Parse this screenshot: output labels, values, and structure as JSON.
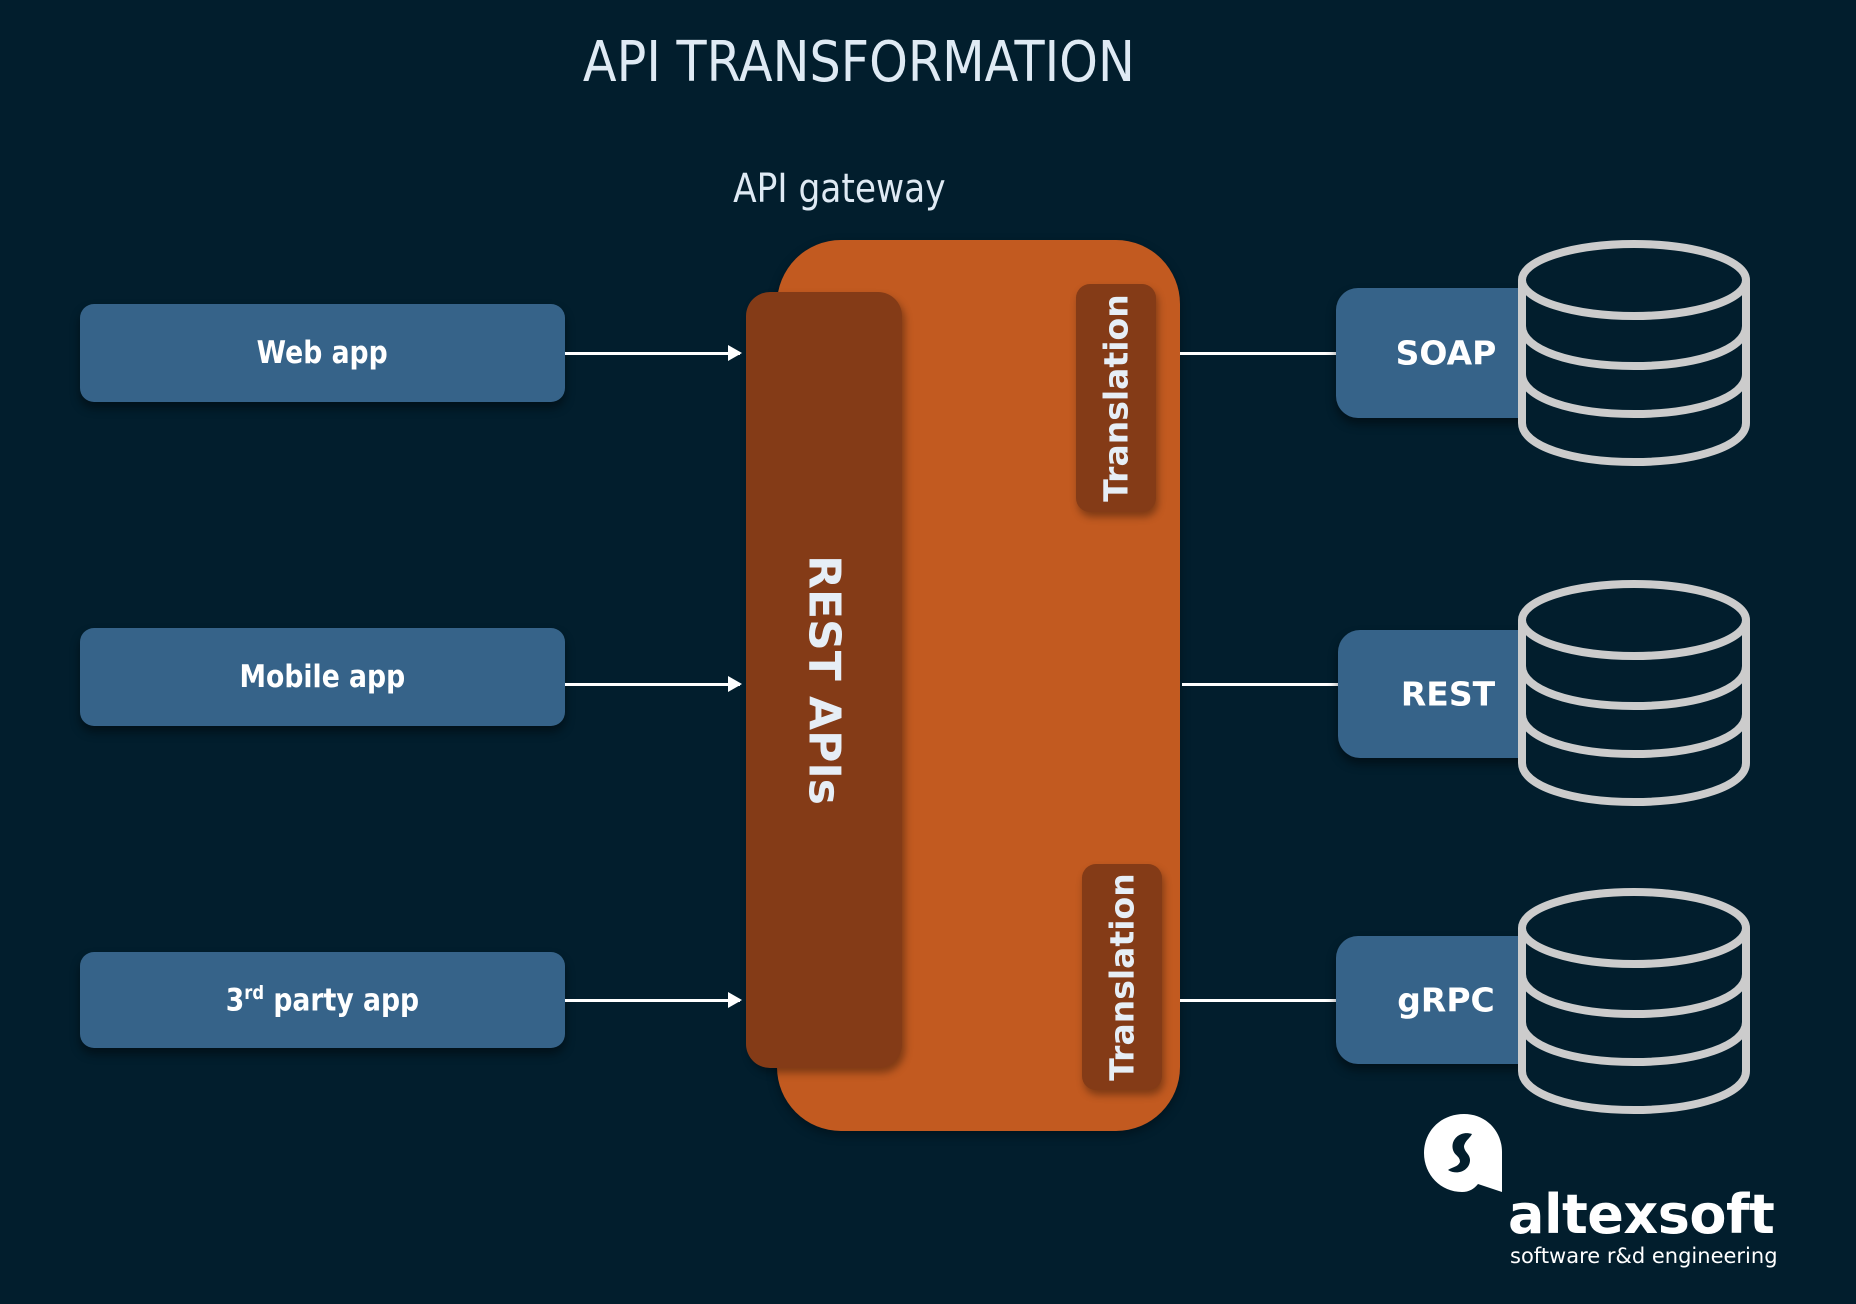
{
  "title": "API TRANSFORMATION",
  "gateway": {
    "label": "API gateway",
    "rest_apis_label": "REST APIs",
    "translation_labels": [
      "Translation",
      "Translation"
    ]
  },
  "clients": [
    {
      "label": "Web app"
    },
    {
      "label": "Mobile app"
    },
    {
      "label_prefix": "3",
      "label_sup": "rd",
      "label_rest": " party app"
    }
  ],
  "backends": [
    {
      "label": "SOAP",
      "icon": "database-icon"
    },
    {
      "label": "REST",
      "icon": "database-icon"
    },
    {
      "label": "gRPC",
      "icon": "database-icon"
    }
  ],
  "brand": {
    "name": "altexsoft",
    "tagline": "software r&d engineering"
  },
  "colors": {
    "background": "#021e2d",
    "client_box": "#366389",
    "gateway": "#c25a20",
    "gateway_inner": "#843b17",
    "database_outline": "#cccccc",
    "text": "#e6eef6"
  }
}
